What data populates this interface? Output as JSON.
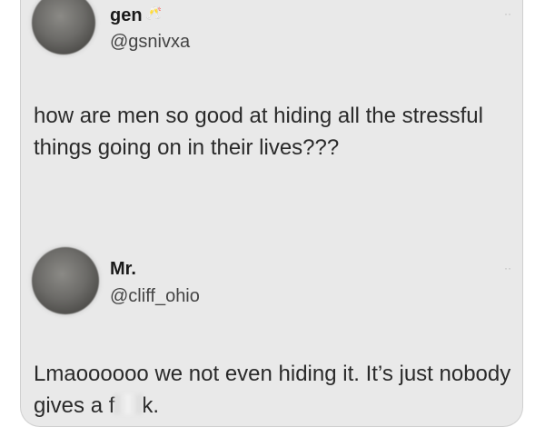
{
  "tweets": [
    {
      "name": "gen",
      "name_emoji": "🥂",
      "handle": "@gsnivxa",
      "text": "how are men so good at hiding all the stressful things going on in their lives???",
      "more": "··"
    },
    {
      "name": "Mr.",
      "handle": "@cliff_ohio",
      "text_before": "Lmaoooooo we not even hiding it. It’s just nobody gives a f",
      "text_after": "k.",
      "more": "··"
    }
  ]
}
